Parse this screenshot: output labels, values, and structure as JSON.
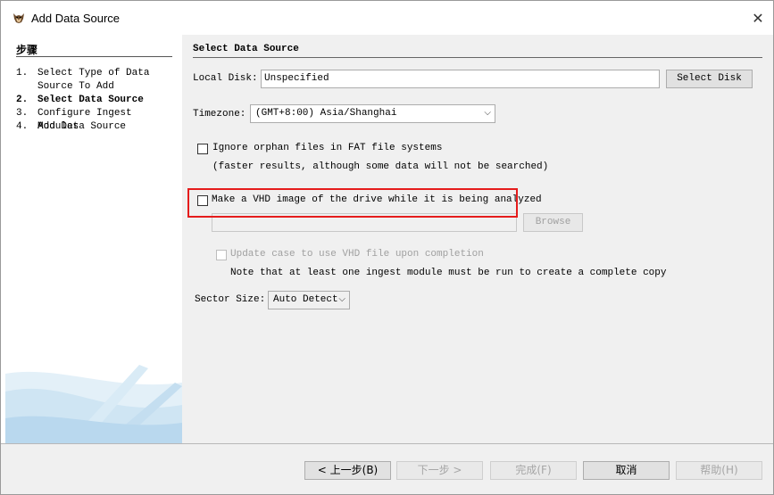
{
  "window": {
    "title": "Add Data Source",
    "close_glyph": "✕"
  },
  "steps": {
    "heading": "步骤",
    "items": [
      {
        "num": "1.",
        "label": "Select Type of Data Source To Add"
      },
      {
        "num": "2.",
        "label": "Select Data Source"
      },
      {
        "num": "3.",
        "label": "Configure Ingest Modules"
      },
      {
        "num": "4.",
        "label": "Add Data Source"
      }
    ],
    "active_index": 1
  },
  "panel": {
    "title": "Select Data Source",
    "local_disk": {
      "label": "Local Disk:",
      "value": "Unspecified",
      "button": "Select Disk"
    },
    "timezone": {
      "label": "Timezone:",
      "value": "(GMT+8:00) Asia/Shanghai"
    },
    "orphan": {
      "label": "Ignore orphan files in FAT file systems",
      "note": "(faster results, although some data will not be searched)",
      "checked": false
    },
    "vhd": {
      "label": "Make a VHD image of the drive while it is being analyzed",
      "path_value": "",
      "browse": "Browse",
      "checked": false
    },
    "update_case": {
      "label": "Update case to use VHD file upon completion",
      "note": "Note that at least one ingest module must be run to create a complete copy",
      "checked": false
    },
    "sector_size": {
      "label": "Sector Size:",
      "value": "Auto Detect"
    }
  },
  "nav": {
    "back": "< 上一步(B)",
    "next": "下一步 >",
    "finish": "完成(F)",
    "cancel": "取消",
    "help": "帮助(H)"
  },
  "colors": {
    "highlight": "#e51c1c",
    "left_bg": "#ffffff",
    "right_bg": "#f0f0f0"
  }
}
